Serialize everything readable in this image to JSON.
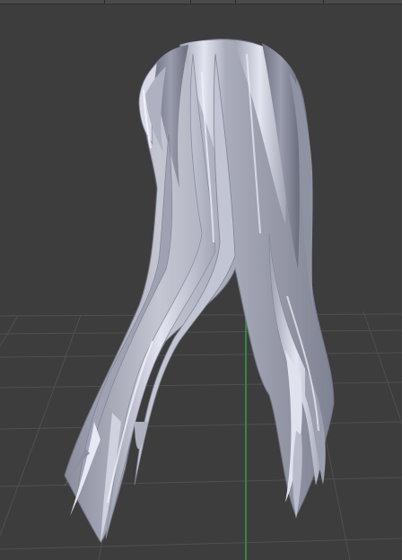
{
  "viewport": {
    "background": "#3d3d3d",
    "grid_color": "#4e4e4e",
    "axis_y_color": "#2f8a3c"
  },
  "model": {
    "description_icon": "hair-mesh",
    "base_color": "#b4b6c4",
    "highlight_color": "#e4e6f2",
    "shadow_color": "#7c7f8f",
    "rim_color": "#c9cdf0"
  }
}
